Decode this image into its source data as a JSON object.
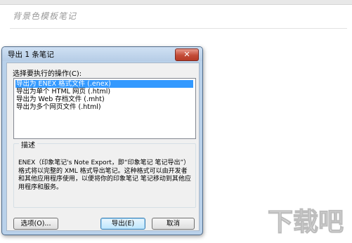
{
  "note": {
    "title": "背景色模板笔记"
  },
  "dialog": {
    "title": "导出 1 条笔记",
    "close_glyph": "✕",
    "prompt": "选择要执行的操作(C):",
    "options": [
      "导出为 ENEX 格式文件 (.enex)",
      "导出为单个 HTML 网页 (.html)",
      "导出为 Web 存档文件 (.mht)",
      "导出为多个网页文件 (.html)"
    ],
    "selected_index": 0,
    "description_heading": "描述",
    "description": "ENEX（印象笔记's Note Export，即“印象笔记 笔记导出”）格式将以完整的 XML 格式导出笔记。这种格式可以由开发者和其他应用程序使用，以便将你的印象笔记 笔记移动到其他应用程序和服务。",
    "buttons": {
      "options": "选项(O)...",
      "export": "导出(E)",
      "cancel": "取消"
    }
  },
  "watermark": {
    "text": "下载吧"
  },
  "colors": {
    "selection": "#3399ff",
    "close_button": "#c44b37",
    "dialog_frame": "#b9d1ea"
  }
}
